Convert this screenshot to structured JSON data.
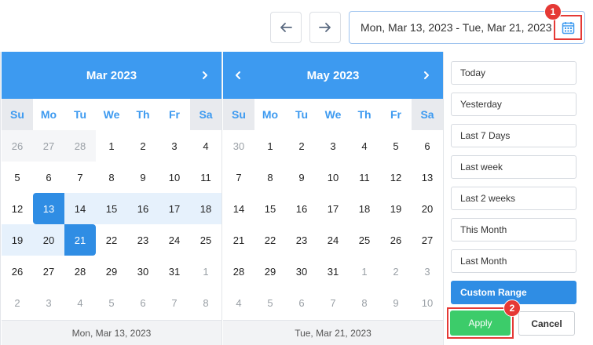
{
  "toolbar": {
    "prev_icon": "arrow-left-icon",
    "next_icon": "arrow-right-icon",
    "range_text": "Mon, Mar 13, 2023 - Tue, Mar 21, 2023",
    "calendar_icon": "calendar-icon"
  },
  "badges": {
    "one": "1",
    "two": "2"
  },
  "weekdays": [
    "Su",
    "Mo",
    "Tu",
    "We",
    "Th",
    "Fr",
    "Sa"
  ],
  "calendars": [
    {
      "title": "Mar 2023",
      "footer": "Mon, Mar 13, 2023",
      "weeks": [
        [
          "26",
          "27",
          "28",
          "1",
          "2",
          "3",
          "4"
        ],
        [
          "5",
          "6",
          "7",
          "8",
          "9",
          "10",
          "11"
        ],
        [
          "12",
          "13",
          "14",
          "15",
          "16",
          "17",
          "18"
        ],
        [
          "19",
          "20",
          "21",
          "22",
          "23",
          "24",
          "25"
        ],
        [
          "26",
          "27",
          "28",
          "29",
          "30",
          "31",
          "1"
        ],
        [
          "2",
          "3",
          "4",
          "5",
          "6",
          "7",
          "8"
        ]
      ]
    },
    {
      "title": "May 2023",
      "footer": "Tue, Mar 21, 2023",
      "weeks": [
        [
          "30",
          "1",
          "2",
          "3",
          "4",
          "5",
          "6"
        ],
        [
          "7",
          "8",
          "9",
          "10",
          "11",
          "12",
          "13"
        ],
        [
          "14",
          "15",
          "16",
          "17",
          "18",
          "19",
          "20"
        ],
        [
          "21",
          "22",
          "23",
          "24",
          "25",
          "26",
          "27"
        ],
        [
          "28",
          "29",
          "30",
          "31",
          "1",
          "2",
          "3"
        ],
        [
          "4",
          "5",
          "6",
          "7",
          "8",
          "9",
          "10"
        ]
      ]
    }
  ],
  "ranges": [
    "Today",
    "Yesterday",
    "Last 7 Days",
    "Last week",
    "Last 2 weeks",
    "This Month",
    "Last Month",
    "Custom Range"
  ],
  "actions": {
    "apply": "Apply",
    "cancel": "Cancel"
  },
  "colors": {
    "accent": "#3d9af0",
    "selected": "#2f8de4",
    "apply": "#3ccc6a",
    "highlight": "#e53935"
  }
}
